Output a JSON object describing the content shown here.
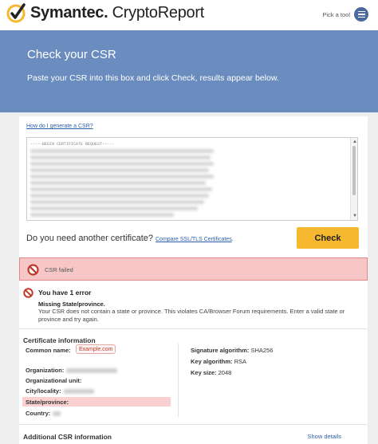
{
  "brand": {
    "name_bold": "Symantec.",
    "name_rest": " CryptoReport",
    "accent": "#f5b82e"
  },
  "header": {
    "pick_label": "Pick a tool"
  },
  "hero": {
    "title": "Check your CSR",
    "subtitle": "Paste your CSR into this box and click Check, results appear below."
  },
  "form": {
    "howto_link": "How do I generate a CSR?",
    "csr_header": "-----BEGIN CERTIFICATE REQUEST-----",
    "another_text": "Do you need another certificate?",
    "compare_link": "Compare SSL/TLS Certificates",
    "compare_suffix": ".",
    "check_label": "Check"
  },
  "status": {
    "text": "CSR failed"
  },
  "errors": {
    "title": "You have 1 error",
    "subtitle": "Missing State/province.",
    "description": "Your CSR does not contain a state or province. This violates CA/Browser Forum requirements. Enter a valid state or province and try again."
  },
  "certificate": {
    "heading": "Certificate information",
    "left": [
      {
        "label": "Common name:"
      },
      {
        "label": "Organization:"
      },
      {
        "label": "Organizational unit:"
      },
      {
        "label": "City/locality:"
      },
      {
        "label": "State/province:"
      },
      {
        "label": "Country:"
      }
    ],
    "common_name_value": "Example.com",
    "right": [
      {
        "label": "Signature algorithm:",
        "value": "SHA256"
      },
      {
        "label": "Key algorithm:",
        "value": "RSA"
      },
      {
        "label": "Key size:",
        "value": "2048"
      }
    ]
  },
  "additional": {
    "heading": "Additional CSR information",
    "show_link": "Show details"
  }
}
